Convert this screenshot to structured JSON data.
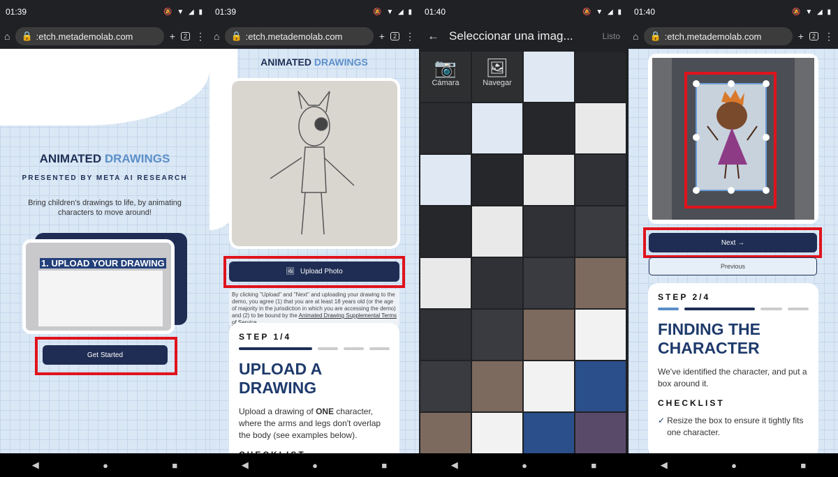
{
  "panels": [
    {
      "time": "01:39",
      "url": ":etch.metademolab.com",
      "tabs": "2"
    },
    {
      "time": "01:39",
      "url": ":etch.metademolab.com",
      "tabs": "2"
    },
    {
      "time": "01:40"
    },
    {
      "time": "01:40",
      "url": ":etch.metademolab.com",
      "tabs": "2"
    }
  ],
  "brand": {
    "part1": "ANIMATED",
    "part2": "DRAWINGS"
  },
  "landing": {
    "subtitle": "PRESENTED BY META AI RESEARCH",
    "tagline": "Bring children's drawings to life, by animating characters to move around!",
    "preview_caption": "1. UPLOAD YOUR DRAWING",
    "get_started": "Get Started"
  },
  "upload": {
    "upload_button": "Upload Photo",
    "terms_text": "By clicking \"Upload\" and \"Next\" and uploading your drawing to the demo, you agree (1) that you are at least 18 years old (or the age of majority in the jurisdiction in which you are accessing the demo) and (2) to be bound by the",
    "terms_link": "Animated Drawing Supplemental Terms of Service.",
    "step": "STEP 1/4",
    "title": "UPLOAD A DRAWING",
    "desc_pre": "Upload a drawing of ",
    "desc_bold": "ONE",
    "desc_post": " character, where the arms and legs don't overlap the body (see examples below).",
    "checklist": "CHECKLIST"
  },
  "picker": {
    "title": "Seleccionar una imag...",
    "done": "Listo",
    "camera": "Cámara",
    "browse": "Navegar"
  },
  "finding": {
    "next": "Next →",
    "previous": "Previous",
    "step": "STEP 2/4",
    "title": "FINDING THE CHARACTER",
    "desc": "We've identified the character, and put a box around it.",
    "checklist": "CHECKLIST",
    "item": "Resize the box to ensure it tightly fits one character."
  },
  "colors": {
    "navy": "#1f2d54",
    "accent": "#5b8fc9",
    "highlight": "#e0131c"
  }
}
